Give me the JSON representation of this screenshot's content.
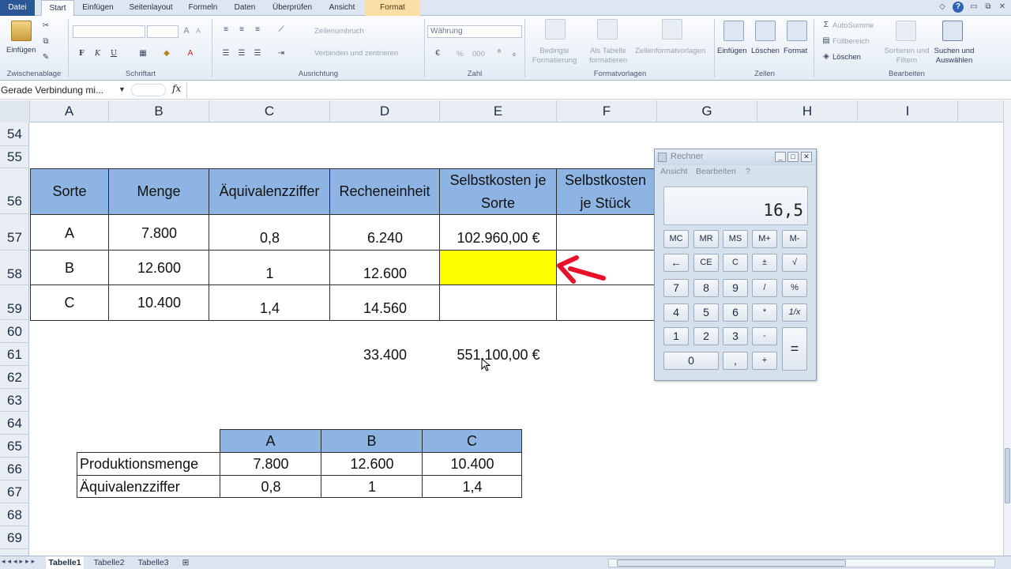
{
  "ribbon_tabs": [
    "Datei",
    "Start",
    "Einfügen",
    "Seitenlayout",
    "Formeln",
    "Daten",
    "Überprüfen",
    "Ansicht",
    "Format"
  ],
  "window_controls": [
    "◇",
    "?",
    "▭",
    "⧉",
    "✕"
  ],
  "ribbon": {
    "clipboard": {
      "paste": "Einfügen",
      "label": "Zwischenablage"
    },
    "font": {
      "bold": "F",
      "italic": "K",
      "underline": "U",
      "grow": "A",
      "shrink": "A",
      "label": "Schriftart"
    },
    "alignment": {
      "wrap": "Zeilenumbruch",
      "merge": "Verbinden und zentrieren",
      "label": "Ausrichtung"
    },
    "number": {
      "format": "Währung",
      "percent": "%",
      "thousands": "000",
      "label": "Zahl"
    },
    "styles": {
      "conditional": "Bedingte Formatierung",
      "as_table": "Als Tabelle formatieren",
      "cell_styles": "Zellenformatvorlagen",
      "label": "Formatvorlagen"
    },
    "cells": {
      "insert": "Einfügen",
      "delete": "Löschen",
      "format": "Format",
      "label": "Zellen"
    },
    "editing": {
      "autosum": "AutoSumme",
      "fill": "Füllbereich",
      "clear": "Löschen",
      "sort": "Sortieren und Filtern",
      "find": "Suchen und Auswählen",
      "label": "Bearbeiten"
    }
  },
  "formula_bar": {
    "name_box": "Gerade Verbindung mi...",
    "fx": "fx",
    "value": ""
  },
  "columns": [
    "A",
    "B",
    "C",
    "D",
    "E",
    "F",
    "G",
    "H",
    "I"
  ],
  "rows": [
    "54",
    "55",
    "56",
    "57",
    "58",
    "59",
    "60",
    "61",
    "62",
    "63",
    "64",
    "65",
    "66",
    "67",
    "68",
    "69"
  ],
  "main_table": {
    "headers": [
      "Sorte",
      "Menge",
      "Äquivalenzziffer",
      "Recheneinheit",
      "Selbstkosten je Sorte",
      "Selbstkosten je Stück"
    ],
    "rows": [
      [
        "A",
        "7.800",
        "0,8",
        "6.240",
        "102.960,00 €",
        ""
      ],
      [
        "B",
        "12.600",
        "1",
        "12.600",
        "",
        ""
      ],
      [
        "C",
        "10.400",
        "1,4",
        "14.560",
        "",
        ""
      ]
    ],
    "totals": {
      "recheneinheit": "33.400",
      "selbstkosten": "551.100,00 €"
    }
  },
  "small_table": {
    "headers": [
      "A",
      "B",
      "C"
    ],
    "rows": [
      {
        "label": "Produktionsmenge",
        "values": [
          "7.800",
          "12.600",
          "10.400"
        ]
      },
      {
        "label": "Äquivalenzziffer",
        "values": [
          "0,8",
          "1",
          "1,4"
        ]
      }
    ]
  },
  "sheet_tabs": [
    "Tabelle1",
    "Tabelle2",
    "Tabelle3"
  ],
  "calculator": {
    "title": "Rechner",
    "menu": [
      "Ansicht",
      "Bearbeiten",
      "?"
    ],
    "display": "16,5",
    "keys": [
      [
        "MC",
        "MR",
        "MS",
        "M+",
        "M-"
      ],
      [
        "←",
        "CE",
        "C",
        "±",
        "√"
      ],
      [
        "7",
        "8",
        "9",
        "/",
        "%"
      ],
      [
        "4",
        "5",
        "6",
        "*",
        "1/x"
      ],
      [
        "1",
        "2",
        "3",
        "-",
        "="
      ],
      [
        "0",
        ",",
        "+"
      ]
    ]
  },
  "colors": {
    "header_fill": "#8db4e2",
    "highlight": "#ffff00",
    "arrow": "#e8102a"
  }
}
